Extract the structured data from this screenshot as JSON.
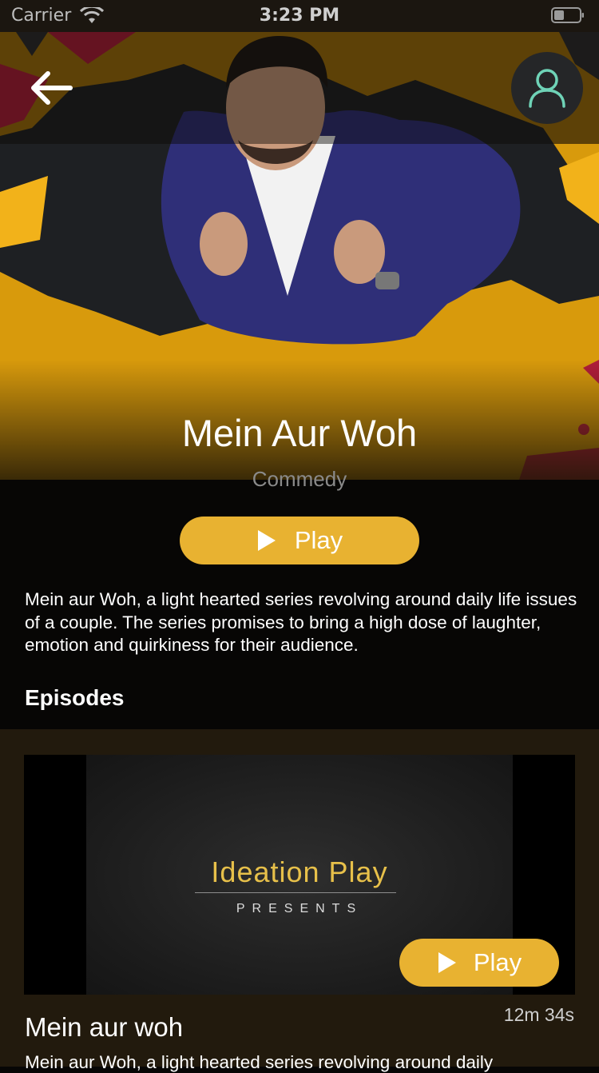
{
  "status_bar": {
    "carrier": "Carrier",
    "time": "3:23 PM"
  },
  "icons": {
    "back": "arrow-left-icon",
    "profile": "user-icon",
    "play": "play-triangle-icon",
    "wifi": "wifi-icon",
    "battery": "battery-icon"
  },
  "colors": {
    "accent": "#e8b231",
    "background": "#070605",
    "episodes_background": "#221a0d",
    "brand_gold": "#e7c04a"
  },
  "show": {
    "title": "Mein Aur Woh",
    "genre": "Commedy",
    "play_label": "Play",
    "description": "Mein aur Woh, a light hearted series revolving around daily life issues of a couple. The series promises to bring a high dose of laughter, emotion and quirkiness for their audience."
  },
  "episodes": {
    "heading": "Episodes",
    "items": [
      {
        "thumbnail_brand": "Ideation Play",
        "thumbnail_subtitle": "PRESENTS",
        "play_label": "Play",
        "duration": "12m 34s",
        "title": "Mein aur woh",
        "description": "Mein aur Woh, a light hearted series revolving around daily"
      }
    ]
  }
}
